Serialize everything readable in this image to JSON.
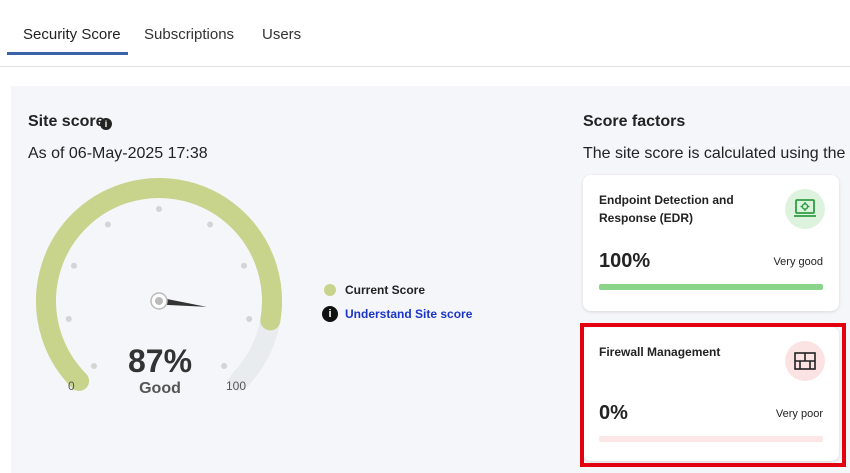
{
  "tabs": [
    {
      "label": "Security Score"
    },
    {
      "label": "Subscriptions"
    },
    {
      "label": "Users"
    }
  ],
  "site": {
    "title": "Site score",
    "info_icon": "info-icon",
    "as_of": "As of 06-May-2025 17:38",
    "score_value": 87,
    "score_text": "87%",
    "score_word": "Good",
    "gauge_min": "0",
    "gauge_max": "100",
    "score_color": "#c8d48b",
    "track_color": "#e8ecef"
  },
  "legend": {
    "current_score": "Current Score",
    "understand_link": "Understand Site score"
  },
  "factors": {
    "title": "Score factors",
    "description": "The site score is calculated using the",
    "items": [
      {
        "name": "Endpoint Detection and Response (EDR)",
        "percent_text": "100%",
        "percent": 100,
        "rating": "Very good",
        "icon": "laptop-shield-icon",
        "bar_color": "#8ad48a",
        "bar_track": "#8ad48a"
      },
      {
        "name": "Firewall Management",
        "percent_text": "0%",
        "percent": 0,
        "rating": "Very poor",
        "icon": "firewall-icon",
        "bar_color": "#f46b6b",
        "bar_track": "#fce6e6"
      }
    ]
  }
}
